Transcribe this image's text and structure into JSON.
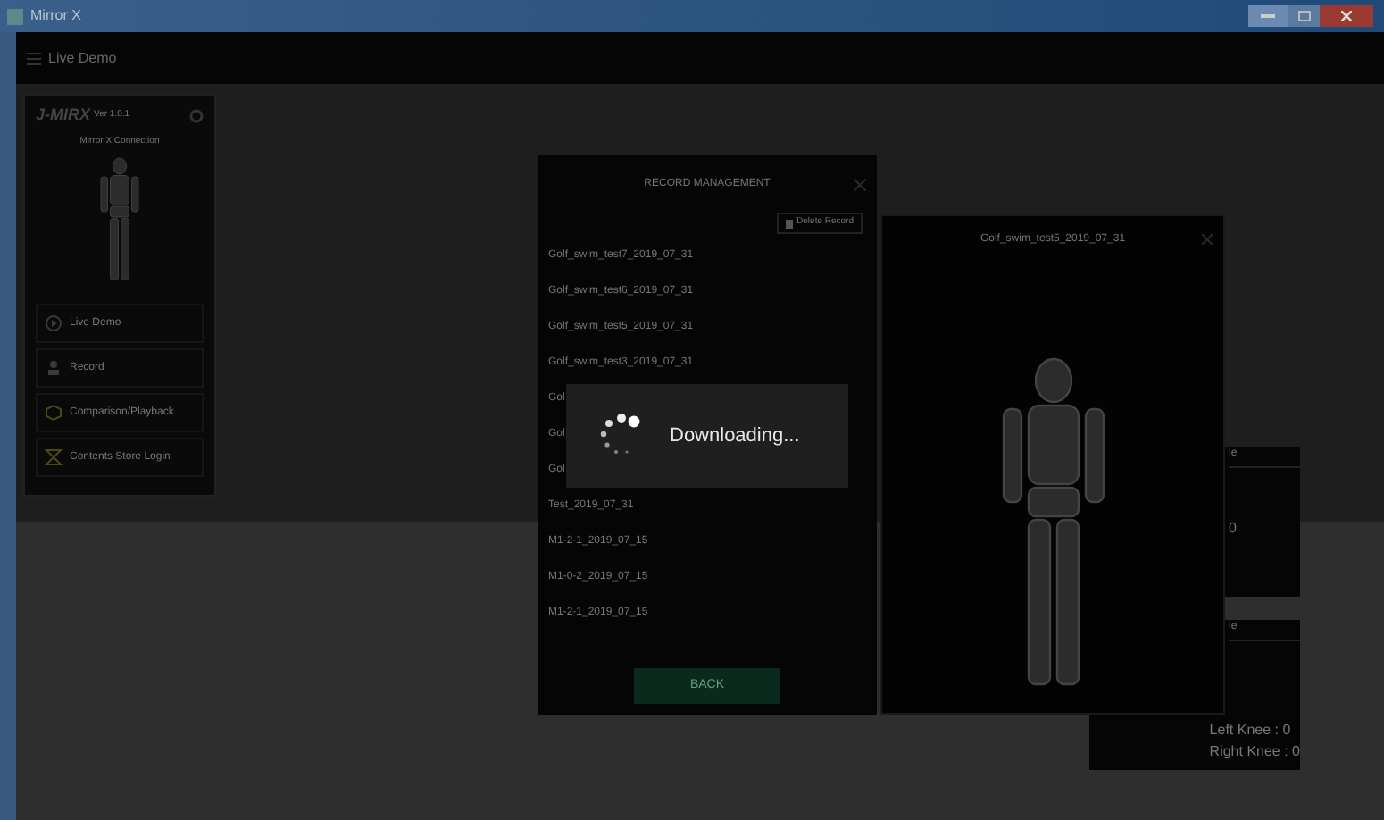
{
  "window": {
    "title": "Mirror X"
  },
  "app_bar": {
    "title": "Live Demo"
  },
  "sidebar": {
    "logo": "J-MIRX",
    "version": "Ver 1.0.1",
    "connection_label": "Mirror X Connection",
    "items": [
      {
        "label": "Live Demo",
        "kind": "play"
      },
      {
        "label": "Record",
        "kind": "record"
      },
      {
        "label": "Comparison/Playback",
        "kind": "compare"
      },
      {
        "label": "Contents Store Login",
        "kind": "store"
      }
    ]
  },
  "record_management": {
    "title": "RECORD MANAGEMENT",
    "delete_button": "Delete Record",
    "records": [
      "Golf_swim_test7_2019_07_31",
      "Golf_swim_test6_2019_07_31",
      "Golf_swim_test5_2019_07_31",
      "Golf_swim_test3_2019_07_31",
      "Gol",
      "Gol",
      "Gol",
      "Test_2019_07_31",
      "M1-2-1_2019_07_15",
      "M1-0-2_2019_07_15",
      "M1-2-1_2019_07_15"
    ],
    "back_button": "BACK"
  },
  "preview": {
    "title": "Golf_swim_test5_2019_07_31"
  },
  "angle_panels": [
    {
      "header": "le",
      "value": "0"
    },
    {
      "header": "le",
      "lines": [
        "Left Knee : 0",
        "Right Knee : 0"
      ]
    }
  ],
  "loading": {
    "message": "Downloading..."
  }
}
